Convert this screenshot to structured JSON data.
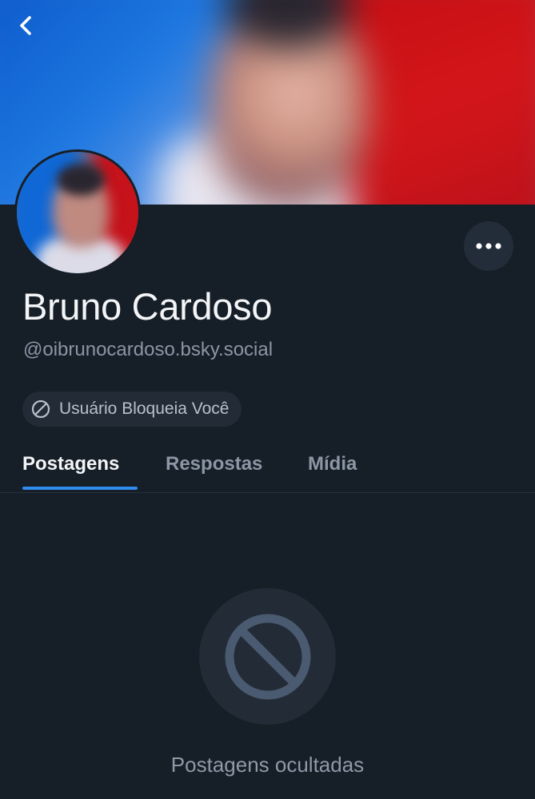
{
  "profile": {
    "display_name": "Bruno Cardoso",
    "handle": "@oibrunocardoso.bsky.social",
    "block_status": "Usuário Bloqueia Você"
  },
  "tabs": [
    {
      "label": "Postagens",
      "active": true
    },
    {
      "label": "Respostas",
      "active": false
    },
    {
      "label": "Mídia",
      "active": false
    }
  ],
  "empty_state": {
    "message": "Postagens ocultadas",
    "icon": "blocked-icon"
  },
  "icons": {
    "back": "chevron-left-icon",
    "more": "ellipsis-icon",
    "block": "block-icon"
  },
  "colors": {
    "background": "#161e27",
    "accent": "#2f8bf0",
    "pill_background": "#222b36",
    "muted_text": "#8b96a5"
  }
}
